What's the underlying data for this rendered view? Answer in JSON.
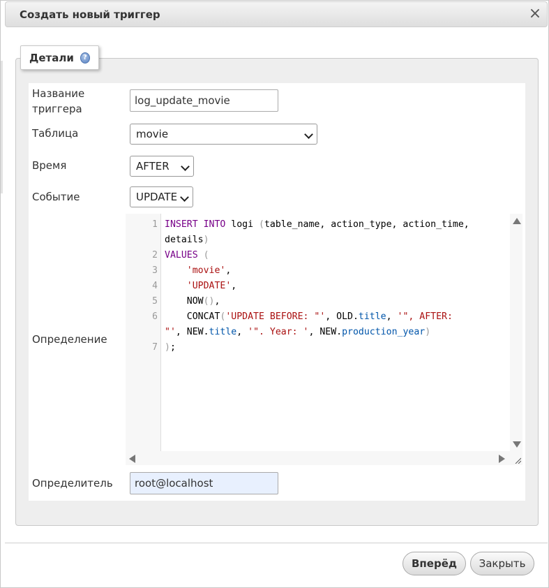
{
  "dialog": {
    "title": "Создать новый триггер",
    "close_glyph": "×"
  },
  "tab": {
    "label": "Детали",
    "help_glyph": "?"
  },
  "form": {
    "name_label_line1": "Название",
    "name_label_line2": "триггера",
    "name_value": "log_update_movie",
    "table_label": "Таблица",
    "table_value": "movie",
    "time_label": "Время",
    "time_value": "AFTER",
    "event_label": "Событие",
    "event_value": "UPDATE",
    "definition_label": "Определение",
    "definer_label": "Определитель",
    "definer_value": "root@localhost"
  },
  "editor": {
    "line_numbers": [
      "1",
      "2",
      "3",
      "4",
      "5",
      "6",
      "7"
    ],
    "code": {
      "l1a_kw": "INSERT INTO",
      "l1a_rest": " logi ",
      "l1a_p1": "(",
      "l1a_cols": "table_name, action_type, action_time,",
      "l1b": "details",
      "l1b_p": ")",
      "l2_kw": "VALUES",
      "l2_p": " (",
      "l3_str": "'movie'",
      "l3_c": ",",
      "l4_str": "'UPDATE'",
      "l4_c": ",",
      "l5_fn": "NOW",
      "l5_p": "()",
      "l5_c": ",",
      "l6a_fn": "CONCAT",
      "l6a_p": "(",
      "l6a_s1": "'UPDATE BEFORE: \"'",
      "l6a_t1": ", OLD.",
      "l6a_prop1": "title",
      "l6a_t2": ", ",
      "l6a_s2": "'\", AFTER:",
      "l6b_s2": "\"'",
      "l6b_t1": ", NEW.",
      "l6b_prop1": "title",
      "l6b_t2": ", ",
      "l6b_s3": "'\". Year: '",
      "l6b_t3": ", NEW.",
      "l6b_prop2": "production_year",
      "l6b_p": ")",
      "l7_p": ")",
      "l7_c": ";"
    }
  },
  "buttons": {
    "forward": "Вперёд",
    "close": "Закрыть"
  }
}
